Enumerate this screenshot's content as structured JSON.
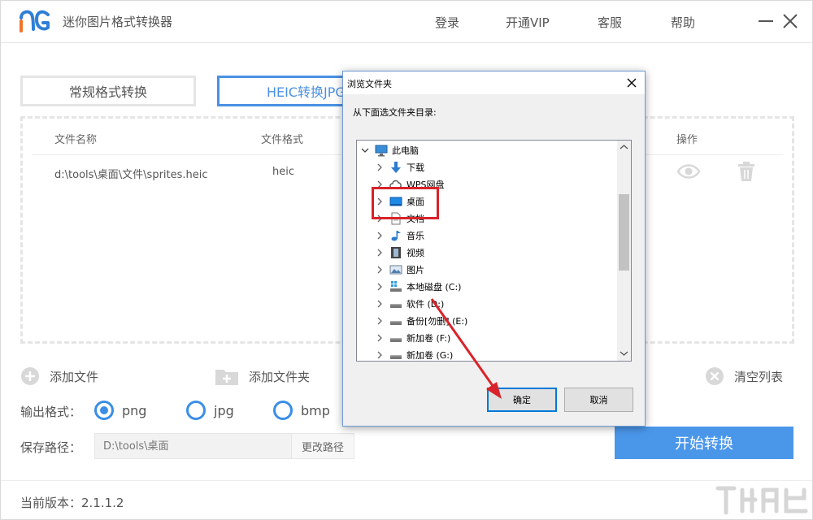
{
  "app": {
    "title": "迷你图片格式转换器",
    "nav": [
      "登录",
      "开通VIP",
      "客服",
      "帮助"
    ]
  },
  "tabs": [
    {
      "label": "常规格式转换"
    },
    {
      "label": "HEIC转换JPG"
    }
  ],
  "file_table": {
    "headers": {
      "name": "文件名称",
      "format": "文件格式",
      "action": "操作"
    },
    "rows": [
      {
        "name": "d:\\tools\\桌面\\文件\\sprites.heic",
        "format": "heic"
      }
    ]
  },
  "actions": {
    "add_file": "添加文件",
    "add_folder": "添加文件夹",
    "clear_list": "清空列表"
  },
  "output": {
    "label": "输出格式：",
    "options": [
      "png",
      "jpg",
      "bmp"
    ],
    "selected": "png"
  },
  "save_path": {
    "label": "保存路径：",
    "value": "D:\\tools\\桌面",
    "change_button": "更改路径"
  },
  "start_button": "开始转换",
  "footer": {
    "version": "当前版本：2.1.1.2"
  },
  "dialog": {
    "title": "浏览文件夹",
    "prompt": "从下面选文件夹目录:",
    "tree": [
      {
        "label": "此电脑",
        "icon": "computer-icon"
      },
      {
        "label": "下载",
        "icon": "download-icon"
      },
      {
        "label": "WPS网盘",
        "icon": "cloud-icon"
      },
      {
        "label": "桌面",
        "icon": "desktop-icon"
      },
      {
        "label": "文档",
        "icon": "document-icon"
      },
      {
        "label": "音乐",
        "icon": "music-icon"
      },
      {
        "label": "视频",
        "icon": "video-icon"
      },
      {
        "label": "图片",
        "icon": "picture-icon"
      },
      {
        "label": "本地磁盘 (C:)",
        "icon": "system-drive-icon"
      },
      {
        "label": "软件 (D:)",
        "icon": "drive-icon"
      },
      {
        "label": "备份[勿删] (E:)",
        "icon": "drive-icon"
      },
      {
        "label": "新加卷 (F:)",
        "icon": "drive-icon"
      },
      {
        "label": "新加卷 (G:)",
        "icon": "drive-icon"
      }
    ],
    "ok_button": "确定",
    "cancel_button": "取消"
  },
  "colors": {
    "accent": "#4a97ea",
    "radio": "#3b8ee6",
    "annotation": "#d9232a",
    "brand_orange": "#f0742b",
    "brand_blue": "#2f7fd6"
  }
}
